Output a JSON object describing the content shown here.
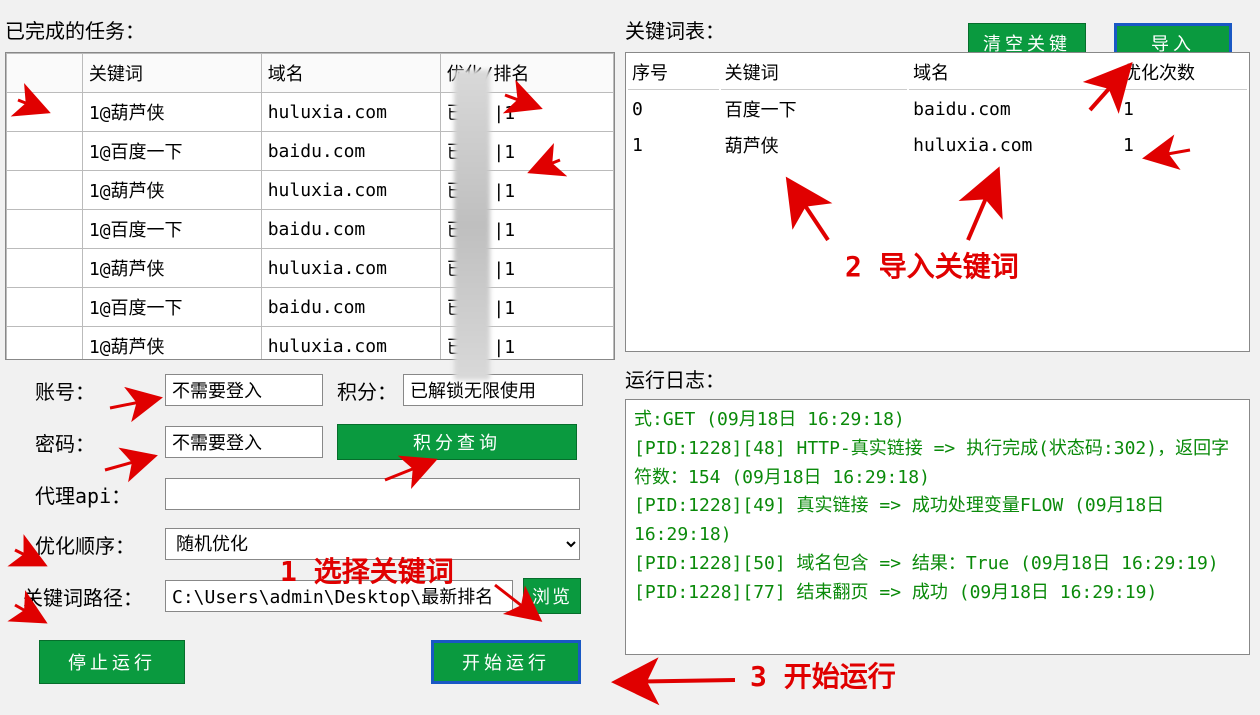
{
  "left": {
    "title": "已完成的任务：",
    "columns": [
      "",
      "关键词",
      "域名",
      "优化/排名"
    ],
    "rows": [
      {
        "c0": "",
        "kw": "1@葫芦侠",
        "dom": "huluxia.com",
        "opt": "已优    |1"
      },
      {
        "c0": "",
        "kw": "1@百度一下",
        "dom": "baidu.com",
        "opt": "已优    |1"
      },
      {
        "c0": "",
        "kw": "1@葫芦侠",
        "dom": "huluxia.com",
        "opt": "已优    |1"
      },
      {
        "c0": "",
        "kw": "1@百度一下",
        "dom": "baidu.com",
        "opt": "已优    |1"
      },
      {
        "c0": "",
        "kw": "1@葫芦侠",
        "dom": "huluxia.com",
        "opt": "已优    |1"
      },
      {
        "c0": "",
        "kw": "1@百度一下",
        "dom": "baidu.com",
        "opt": "已优    |1"
      },
      {
        "c0": "",
        "kw": "1@葫芦侠",
        "dom": "huluxia.com",
        "opt": "已优    |1"
      }
    ]
  },
  "form": {
    "account_label": "账号：",
    "account_value": "不需要登入",
    "points_label": "积分：",
    "points_value": "已解锁无限使用",
    "password_label": "密码：",
    "password_value": "不需要登入",
    "points_query_btn": "积分查询",
    "proxy_label": "代理api：",
    "proxy_value": "",
    "order_label": "优化顺序：",
    "order_value": "随机优化",
    "path_label": "关键词路径：",
    "path_value": "C:\\Users\\admin\\Desktop\\最新排名",
    "browse_btn": "浏览",
    "stop_btn": "停止运行",
    "start_btn": "开始运行"
  },
  "right": {
    "title": "关键词表：",
    "clear_btn": "清空关键",
    "import_btn": "导入",
    "columns": [
      "序号",
      "关键词",
      "域名",
      "优化次数"
    ],
    "rows": [
      {
        "idx": "0",
        "kw": "百度一下",
        "dom": "baidu.com",
        "cnt": "1"
      },
      {
        "idx": "1",
        "kw": "葫芦侠",
        "dom": "huluxia.com",
        "cnt": "1"
      }
    ]
  },
  "log": {
    "title": "运行日志：",
    "lines": [
      "式:GET (09月18日 16:29:18)",
      "[PID:1228][48] HTTP-真实链接 => 执行完成(状态码:302)，返回字符数：154 (09月18日 16:29:18)",
      "[PID:1228][49] 真实链接 => 成功处理变量FLOW (09月18日 16:29:18)",
      "[PID:1228][50] 域名包含 => 结果：True (09月18日 16:29:19)",
      "[PID:1228][77] 结束翻页 => 成功 (09月18日 16:29:19)"
    ]
  },
  "annotations": {
    "step1": "1 选择关键词",
    "step2": "2 导入关键词",
    "step3": "3 开始运行"
  }
}
